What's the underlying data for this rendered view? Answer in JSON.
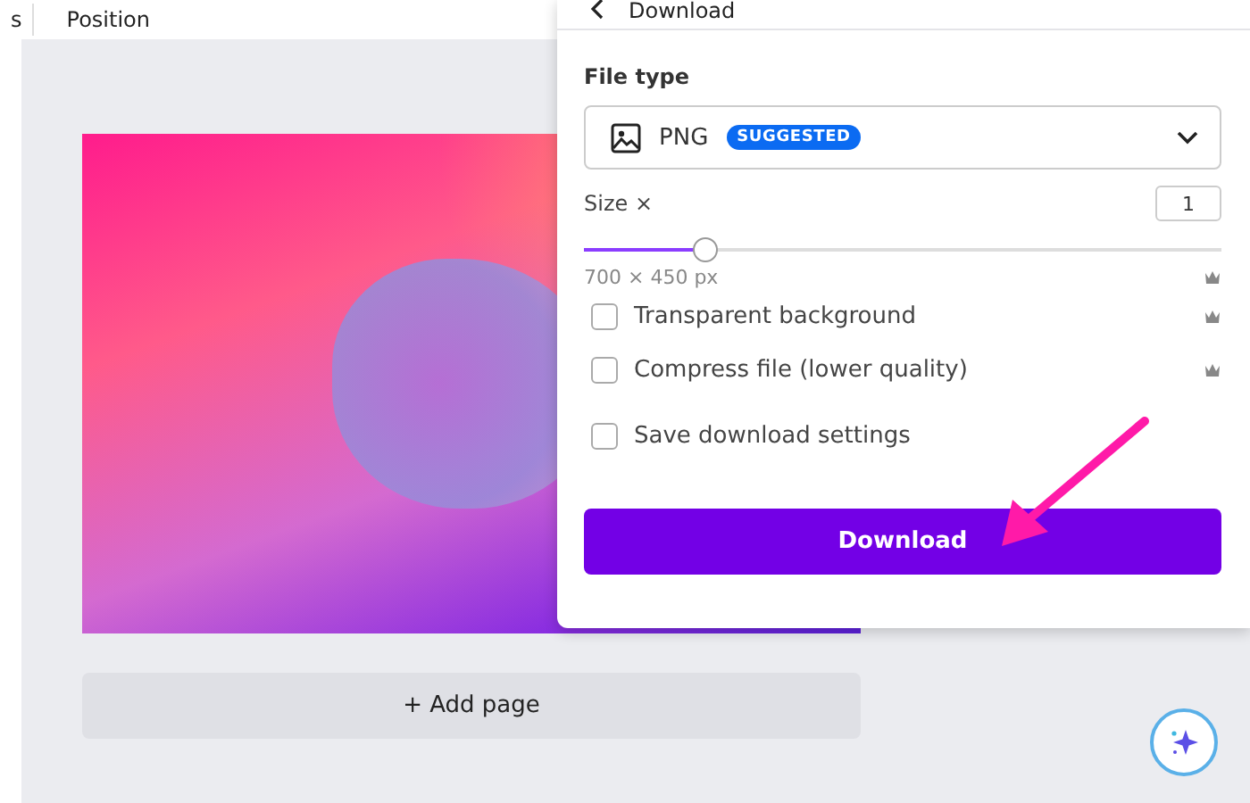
{
  "toolbar": {
    "items": [
      "s",
      "Position"
    ]
  },
  "canvas": {
    "add_page": "+ Add page"
  },
  "panel": {
    "title": "Download",
    "file_type": {
      "label": "File type",
      "value": "PNG",
      "badge": "SUGGESTED"
    },
    "size": {
      "label": "Size ×",
      "value": "1",
      "level": 0.19,
      "dimensions": "700 × 450 px",
      "premium": true
    },
    "options": [
      {
        "label": "Transparent background",
        "checked": false,
        "premium": true
      },
      {
        "label": "Compress file (lower quality)",
        "checked": false,
        "premium": true
      },
      {
        "label": "Save download settings",
        "checked": false,
        "premium": false
      }
    ],
    "download_button": "Download"
  }
}
